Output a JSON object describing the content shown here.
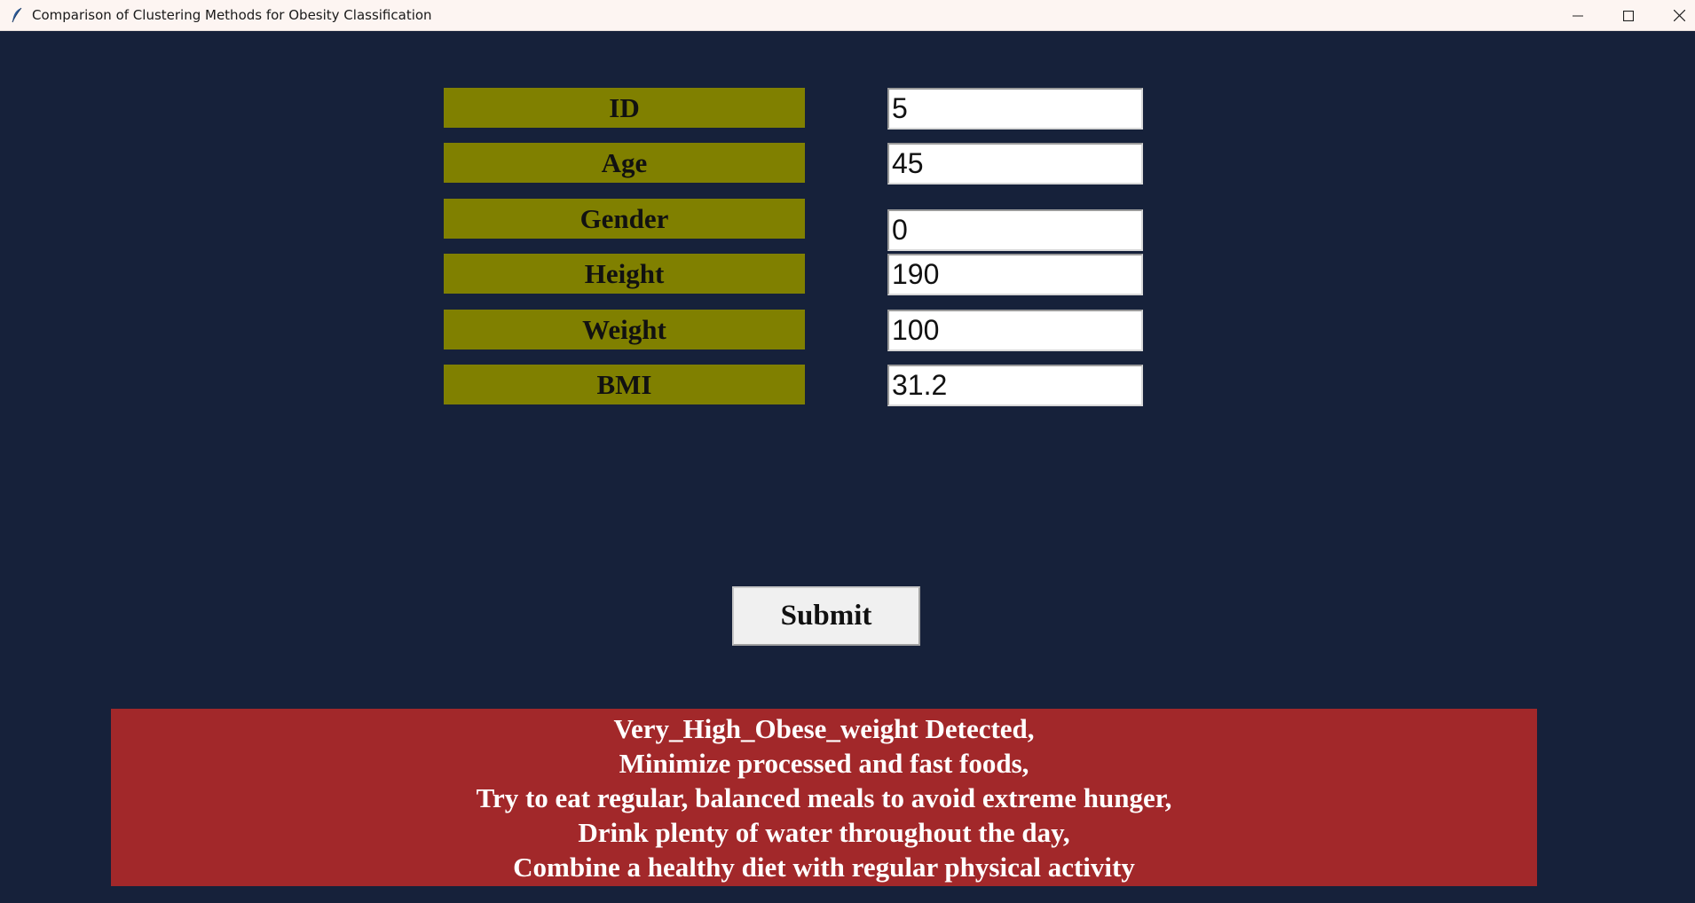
{
  "window": {
    "title": "Comparison of Clustering Methods for Obesity Classification",
    "app_icon": "feather-icon",
    "controls": {
      "minimize_icon": "minimize-icon",
      "maximize_icon": "maximize-icon",
      "close_icon": "close-icon"
    }
  },
  "form": {
    "fields": [
      {
        "label": "ID",
        "value": "5"
      },
      {
        "label": "Age",
        "value": "45"
      },
      {
        "label": "Gender",
        "value": "0"
      },
      {
        "label": "Height",
        "value": "190"
      },
      {
        "label": "Weight",
        "value": "100"
      },
      {
        "label": "BMI",
        "value": "31.2"
      }
    ],
    "submit_label": "Submit"
  },
  "result": {
    "lines": [
      "Very_High_Obese_weight Detected,",
      "Minimize processed and fast foods,",
      "Try to eat regular, balanced meals to avoid extreme hunger,",
      "Drink plenty of water throughout the day,",
      "Combine a healthy diet with regular physical activity"
    ]
  },
  "colors": {
    "background": "#16213a",
    "label_bg": "#808000",
    "result_bg": "#a2282a",
    "titlebar_bg": "#fdf5f2"
  }
}
